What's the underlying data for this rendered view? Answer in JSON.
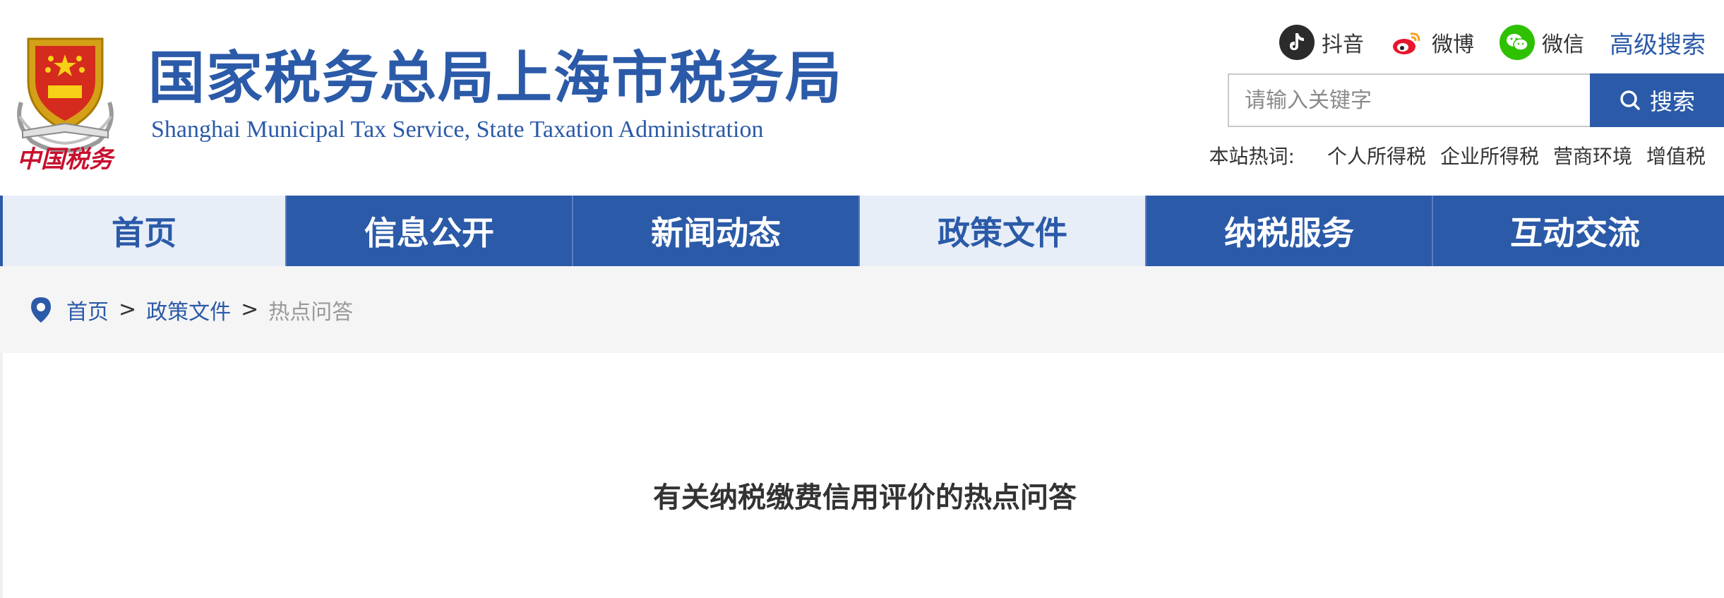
{
  "header": {
    "emblem_text": "中国税务",
    "title_cn": "国家税务总局上海市税务局",
    "title_en": "Shanghai Municipal Tax Service, State Taxation Administration"
  },
  "social": [
    {
      "label": "抖音",
      "icon": "douyin-icon",
      "color": "#2b2b2b"
    },
    {
      "label": "微博",
      "icon": "weibo-icon",
      "color": "#e6162d"
    },
    {
      "label": "微信",
      "icon": "wechat-icon",
      "color": "#2dc100"
    }
  ],
  "advanced_search": "高级搜索",
  "search": {
    "placeholder": "请输入关键字",
    "button_label": "搜索"
  },
  "hotwords": {
    "label": "本站热词:",
    "items": [
      "个人所得税",
      "企业所得税",
      "营商环境",
      "增值税"
    ]
  },
  "nav": [
    {
      "label": "首页",
      "style": "light"
    },
    {
      "label": "信息公开",
      "style": "dark"
    },
    {
      "label": "新闻动态",
      "style": "dark"
    },
    {
      "label": "政策文件",
      "style": "light"
    },
    {
      "label": "纳税服务",
      "style": "dark"
    },
    {
      "label": "互动交流",
      "style": "dark"
    }
  ],
  "breadcrumb": {
    "items": [
      "首页",
      "政策文件"
    ],
    "separator": ">",
    "current": "热点问答"
  },
  "article": {
    "title": "有关纳税缴费信用评价的热点问答"
  },
  "colors": {
    "brand_blue": "#2b5aa8",
    "nav_light": "#e8eef8",
    "crumb_bg": "#f5f5f5"
  }
}
